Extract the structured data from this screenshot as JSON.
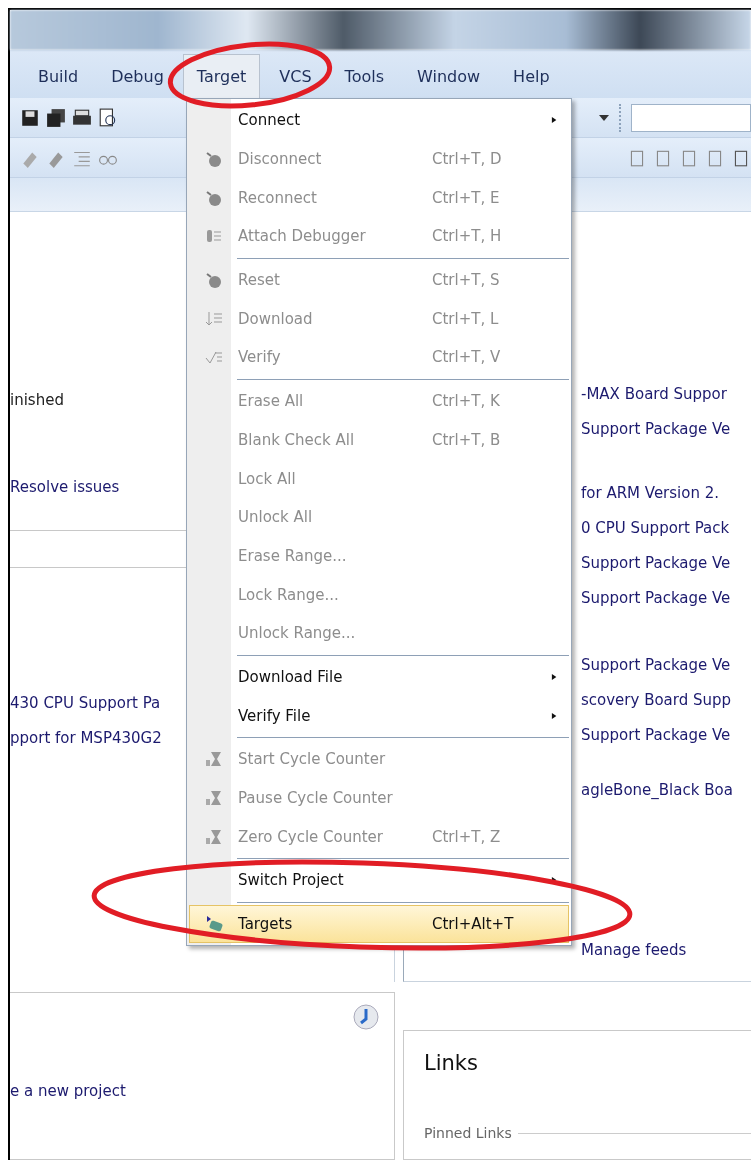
{
  "menubar": [
    {
      "label": "Build",
      "selected": false
    },
    {
      "label": "Debug",
      "selected": false
    },
    {
      "label": "Target",
      "selected": true
    },
    {
      "label": "VCS",
      "selected": false
    },
    {
      "label": "Tools",
      "selected": false
    },
    {
      "label": "Window",
      "selected": false
    },
    {
      "label": "Help",
      "selected": false
    }
  ],
  "target_menu": [
    {
      "kind": "item",
      "label": "Connect",
      "disabled": false,
      "submenu": true,
      "selected": false
    },
    {
      "kind": "item",
      "label": "Disconnect",
      "shortcut": "Ctrl+T, D",
      "disabled": true,
      "submenu": false,
      "selected": false
    },
    {
      "kind": "item",
      "label": "Reconnect",
      "shortcut": "Ctrl+T, E",
      "disabled": true,
      "submenu": false,
      "selected": false
    },
    {
      "kind": "item",
      "label": "Attach Debugger",
      "shortcut": "Ctrl+T, H",
      "disabled": true,
      "submenu": false,
      "selected": false
    },
    {
      "kind": "separator"
    },
    {
      "kind": "item",
      "label": "Reset",
      "shortcut": "Ctrl+T, S",
      "disabled": true,
      "submenu": false,
      "selected": false
    },
    {
      "kind": "item",
      "label": "Download",
      "shortcut": "Ctrl+T, L",
      "disabled": true,
      "submenu": false,
      "selected": false
    },
    {
      "kind": "item",
      "label": "Verify",
      "shortcut": "Ctrl+T, V",
      "disabled": true,
      "submenu": false,
      "selected": false
    },
    {
      "kind": "separator"
    },
    {
      "kind": "item",
      "label": "Erase All",
      "shortcut": "Ctrl+T, K",
      "disabled": true,
      "submenu": false,
      "selected": false
    },
    {
      "kind": "item",
      "label": "Blank Check All",
      "shortcut": "Ctrl+T, B",
      "disabled": true,
      "submenu": false,
      "selected": false
    },
    {
      "kind": "item",
      "label": "Lock All",
      "disabled": true,
      "submenu": false,
      "selected": false
    },
    {
      "kind": "item",
      "label": "Unlock All",
      "disabled": true,
      "submenu": false,
      "selected": false
    },
    {
      "kind": "item",
      "label": "Erase Range...",
      "disabled": true,
      "submenu": false,
      "selected": false
    },
    {
      "kind": "item",
      "label": "Lock Range...",
      "disabled": true,
      "submenu": false,
      "selected": false
    },
    {
      "kind": "item",
      "label": "Unlock Range...",
      "disabled": true,
      "submenu": false,
      "selected": false
    },
    {
      "kind": "separator"
    },
    {
      "kind": "item",
      "label": "Download File",
      "disabled": false,
      "submenu": true,
      "selected": false
    },
    {
      "kind": "item",
      "label": "Verify File",
      "disabled": false,
      "submenu": true,
      "selected": false
    },
    {
      "kind": "separator"
    },
    {
      "kind": "item",
      "label": "Start Cycle Counter",
      "disabled": true,
      "submenu": false,
      "selected": false
    },
    {
      "kind": "item",
      "label": "Pause Cycle Counter",
      "disabled": true,
      "submenu": false,
      "selected": false
    },
    {
      "kind": "item",
      "label": "Zero Cycle Counter",
      "shortcut": "Ctrl+T, Z",
      "disabled": true,
      "submenu": false,
      "selected": false
    },
    {
      "kind": "separator"
    },
    {
      "kind": "item",
      "label": "Switch Project",
      "disabled": false,
      "submenu": true,
      "selected": false
    },
    {
      "kind": "separator"
    },
    {
      "kind": "item",
      "label": "Targets",
      "shortcut": "Ctrl+Alt+T",
      "disabled": false,
      "submenu": false,
      "selected": true
    }
  ],
  "left_panel": {
    "status": "inished",
    "issues_link": "Resolve issues",
    "packages": [
      "430 CPU Support Pa",
      "pport for MSP430G2"
    ]
  },
  "right_panel": {
    "groups": [
      [
        "-MAX Board Suppor",
        "Support Package Ve"
      ],
      [
        "for ARM Version 2.",
        "0 CPU Support Pack",
        "Support Package Ve",
        "Support Package Ve"
      ],
      [
        "Support Package Ve",
        "scovery Board Supp",
        "Support Package Ve"
      ],
      [
        "agleBone_Black Boa"
      ]
    ],
    "manage_link": "Manage feeds"
  },
  "projects_panel": {
    "link": "e a new project"
  },
  "links_panel": {
    "title": "Links",
    "pinned_label": "Pinned Links"
  }
}
